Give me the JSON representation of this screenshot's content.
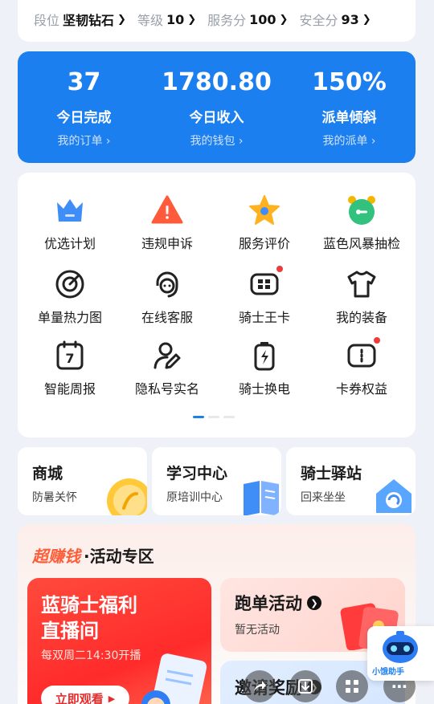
{
  "tier": [
    {
      "label": "段位",
      "value": "坚韧钻石"
    },
    {
      "label": "等级",
      "value": "10"
    },
    {
      "label": "服务分",
      "value": "100"
    },
    {
      "label": "安全分",
      "value": "93"
    }
  ],
  "stats": [
    {
      "number": "37",
      "title": "今日完成",
      "link": "我的订单"
    },
    {
      "number": "1780.80",
      "title": "今日收入",
      "link": "我的钱包"
    },
    {
      "number": "150%",
      "title": "派单倾斜",
      "link": "我的派单"
    }
  ],
  "grid": [
    {
      "label": "优选计划",
      "icon": "crown-icon"
    },
    {
      "label": "违规申诉",
      "icon": "warning-icon"
    },
    {
      "label": "服务评价",
      "icon": "star-icon"
    },
    {
      "label": "蓝色风暴抽检",
      "icon": "alarm-clock-icon"
    },
    {
      "label": "单量热力图",
      "icon": "target-icon"
    },
    {
      "label": "在线客服",
      "icon": "headset-icon"
    },
    {
      "label": "骑士王卡",
      "icon": "card-icon"
    },
    {
      "label": "我的装备",
      "icon": "tshirt-icon"
    },
    {
      "label": "智能周报",
      "icon": "calendar-icon",
      "calendar_day": "7"
    },
    {
      "label": "隐私号实名",
      "icon": "user-edit-icon"
    },
    {
      "label": "骑士换电",
      "icon": "battery-swap-icon"
    },
    {
      "label": "卡券权益",
      "icon": "coupon-icon"
    }
  ],
  "mini_cards": [
    {
      "title": "商城",
      "subtitle": "防暑关怀"
    },
    {
      "title": "学习中心",
      "subtitle": "原培训中心"
    },
    {
      "title": "骑士驿站",
      "subtitle": "回来坐坐"
    }
  ],
  "activity": {
    "highlight": "超赚钱",
    "title": "·活动专区",
    "live": {
      "line1": "蓝骑士福利",
      "line2": "直播间",
      "time": "每双周二14:30开播",
      "button": "立即观看"
    },
    "run": {
      "title": "跑单活动",
      "subtitle": "暂无活动"
    },
    "invite": {
      "title": "邀请奖励"
    }
  },
  "assistant": {
    "label": "小饿助手"
  },
  "colors": {
    "primary": "#1c7ff0",
    "accent": "#ff5c38",
    "badge": "#ef3b3b"
  }
}
